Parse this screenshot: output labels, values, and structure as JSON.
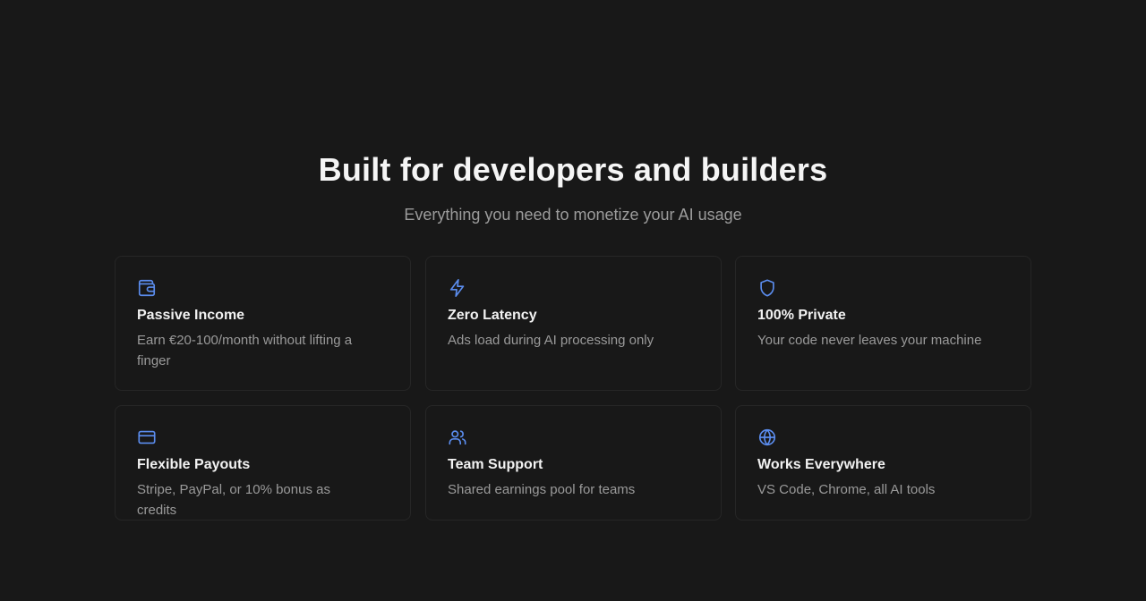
{
  "section": {
    "title": "Built for developers and builders",
    "subtitle": "Everything you need to monetize your AI usage"
  },
  "accent_color": "#5b8def",
  "features": [
    {
      "icon": "wallet-icon",
      "title": "Passive Income",
      "description": "Earn €20-100/month without lifting a finger"
    },
    {
      "icon": "lightning-icon",
      "title": "Zero Latency",
      "description": "Ads load during AI processing only"
    },
    {
      "icon": "shield-icon",
      "title": "100% Private",
      "description": "Your code never leaves your machine"
    },
    {
      "icon": "credit-card-icon",
      "title": "Flexible Payouts",
      "description": "Stripe, PayPal, or 10% bonus as credits"
    },
    {
      "icon": "users-icon",
      "title": "Team Support",
      "description": "Shared earnings pool for teams"
    },
    {
      "icon": "globe-icon",
      "title": "Works Everywhere",
      "description": "VS Code, Chrome, all AI tools"
    }
  ]
}
